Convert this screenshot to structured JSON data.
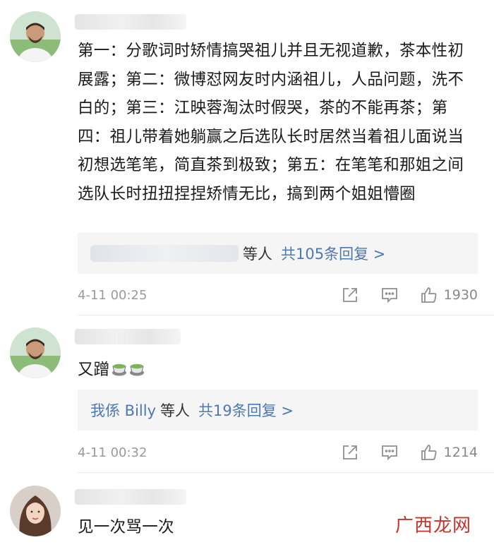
{
  "comments": [
    {
      "avatar": "man-avatar",
      "text": "第一：分歌词时矫情搞哭祖儿并且无视道歉，茶本性初展露；第二：微博怼网友时内涵祖儿，人品问题，洗不白的；第三：江映蓉淘汰时假哭，茶的不能再茶；第四：祖儿带着她躺赢之后选队长时居然当着祖儿面说当初想选笔笔，简直茶到极致；第五：在笔笔和那姐之间选队长时扭扭捏捏矫情无比，搞到两个姐姐懵圈",
      "reply_others": "等人",
      "reply_link": "共105条回复 >",
      "time": "4-11 00:25",
      "likes": "1930"
    },
    {
      "avatar": "man-avatar",
      "text": "又蹭",
      "emoji": [
        "tea-emoji",
        "tea-emoji"
      ],
      "reply_names": "我係 Billy",
      "reply_others": "等人",
      "reply_link": "共19条回复 >",
      "time": "4-11 00:32",
      "likes": "1214"
    },
    {
      "avatar": "woman-avatar",
      "text": "见一次骂一次"
    }
  ],
  "watermark": "广西龙网",
  "colors": {
    "link": "#4e78b3",
    "watermark": "#c7322a",
    "reply_bg": "#f5f5f5"
  }
}
